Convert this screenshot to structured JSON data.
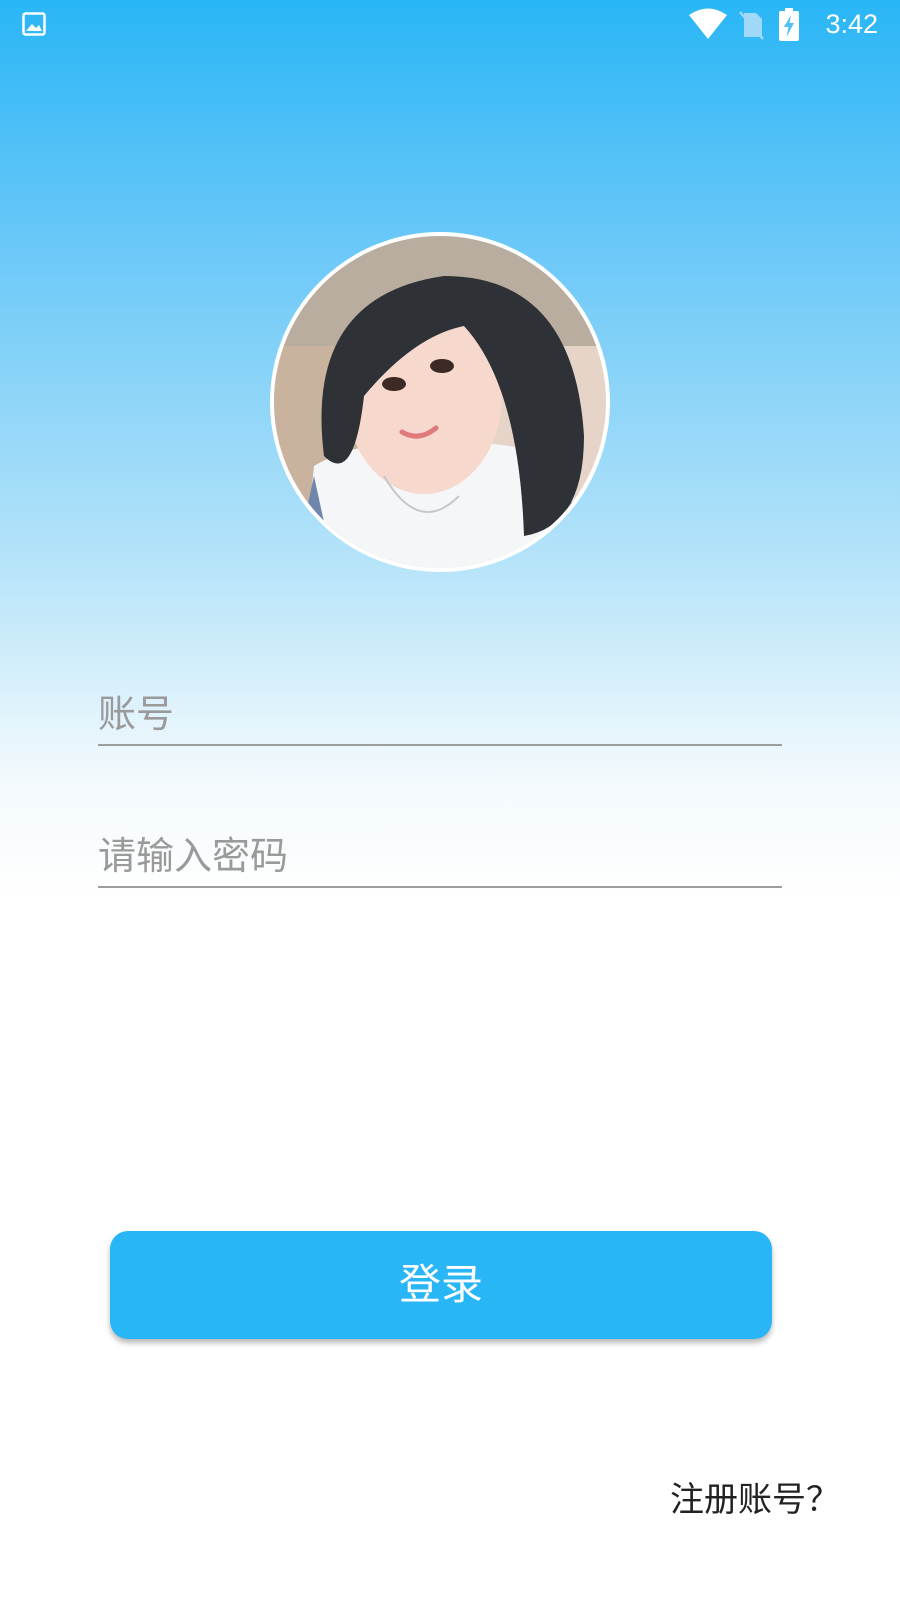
{
  "status_bar": {
    "time": "3:42",
    "icons": [
      "gallery-icon",
      "wifi-icon",
      "no-sim-icon",
      "battery-charging-icon"
    ]
  },
  "login_form": {
    "avatar": "avatar",
    "account_placeholder": "账号",
    "password_placeholder": "请输入密码",
    "login_label": "登录",
    "register_label": "注册账号？"
  },
  "colors": {
    "accent": "#29b6f6",
    "background_top": "#29b6f6",
    "background_bottom": "#ffffff",
    "underline": "#9e9e9e",
    "placeholder": "#9a9a9a"
  }
}
